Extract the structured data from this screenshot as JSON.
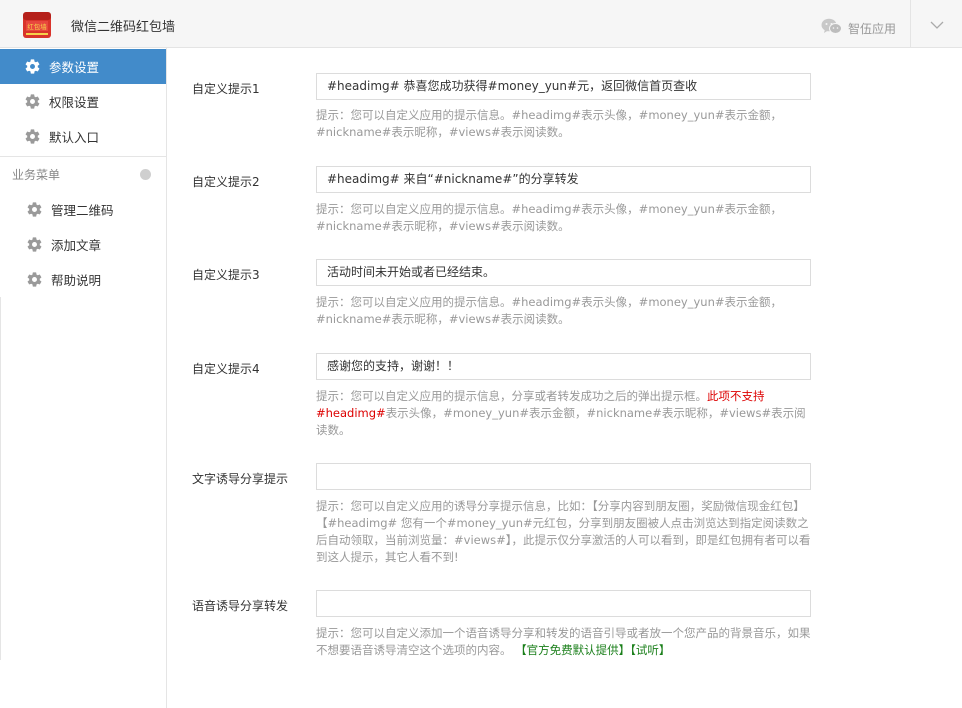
{
  "header": {
    "app_title": "微信二维码红包墙",
    "logo_text": "红包墙",
    "service_label": "智伍应用",
    "colors": {
      "logo_bg": "#d9342b",
      "logo_text": "#f5d24b"
    }
  },
  "sidebar": {
    "items": [
      {
        "label": "参数设置",
        "icon": "gear-icon",
        "active": true
      },
      {
        "label": "权限设置",
        "icon": "gear-icon",
        "active": false
      },
      {
        "label": "默认入口",
        "icon": "gear-icon",
        "active": false
      }
    ],
    "section_title": "业务菜单",
    "section_items": [
      {
        "label": "管理二维码",
        "icon": "gear-icon"
      },
      {
        "label": "添加文章",
        "icon": "gear-icon"
      },
      {
        "label": "帮助说明",
        "icon": "gear-icon"
      }
    ],
    "colors": {
      "active_bg": "#428bca"
    }
  },
  "form": {
    "fields": [
      {
        "label": "自定义提示1",
        "value": "#headimg#  恭喜您成功获得#money_yun#元，返回微信首页查收",
        "help": "提示：您可以自定义应用的提示信息。#headimg#表示头像，#money_yun#表示金额，#nickname#表示昵称，#views#表示阅读数。"
      },
      {
        "label": "自定义提示2",
        "value": "#headimg#  来自“#nickname#”的分享转发",
        "help": "提示：您可以自定义应用的提示信息。#headimg#表示头像，#money_yun#表示金额，#nickname#表示昵称，#views#表示阅读数。"
      },
      {
        "label": "自定义提示3",
        "value": "活动时间未开始或者已经结束。",
        "help": "提示：您可以自定义应用的提示信息。#headimg#表示头像，#money_yun#表示金额，#nickname#表示昵称，#views#表示阅读数。"
      },
      {
        "label": "自定义提示4",
        "value": "感谢您的支持，谢谢！！",
        "help_prefix": "提示：您可以自定义应用的提示信息，分享或者转发成功之后的弹出提示框。",
        "help_warning": "此项不支持#headimg#",
        "help_suffix": "表示头像，#money_yun#表示金额，#nickname#表示昵称，#views#表示阅读数。"
      },
      {
        "label": "文字诱导分享提示",
        "value": "",
        "help": "提示：您可以自定义应用的诱导分享提示信息，比如：【分享内容到朋友圈，奖励微信现金红包】【#headimg# 您有一个#money_yun#元红包，分享到朋友圈被人点击浏览达到指定阅读数之后自动领取，当前浏览量：#views#】，此提示仅分享激活的人可以看到，即是红包拥有者可以看到这人提示，其它人看不到!"
      },
      {
        "label": "语音诱导分享转发",
        "value": "",
        "help_prefix": "提示：您可以自定义添加一个语音诱导分享和转发的语音引导或者放一个您产品的背景音乐，如果不想要语音诱导清空这个选项的内容。",
        "help_link1": "【官方免费默认提供】",
        "help_link2": "【试听】"
      }
    ],
    "colors": {
      "help_text": "#999999",
      "warning": "#dd0000",
      "link_green": "#1a7f1a"
    }
  }
}
